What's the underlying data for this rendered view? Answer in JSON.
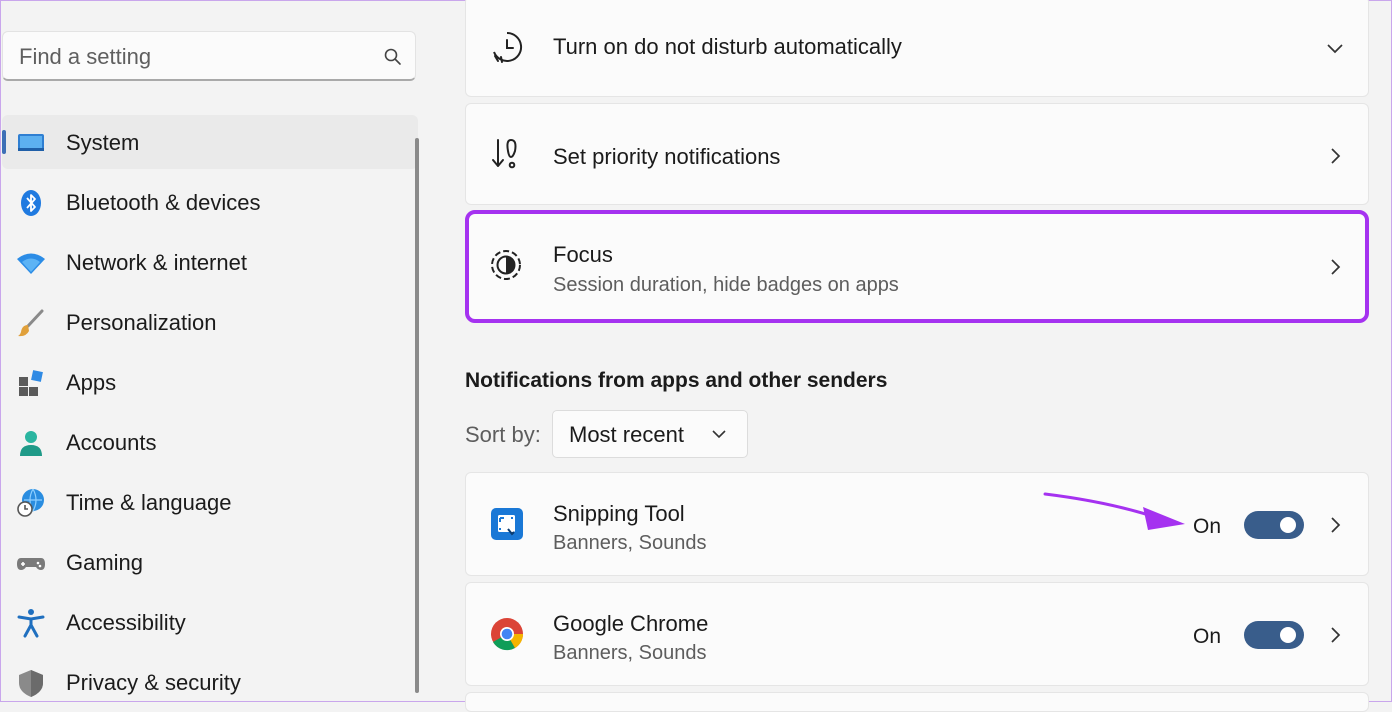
{
  "search": {
    "placeholder": "Find a setting"
  },
  "sidebar": {
    "items": [
      {
        "label": "System",
        "icon": "system-icon",
        "active": true
      },
      {
        "label": "Bluetooth & devices",
        "icon": "bluetooth-icon"
      },
      {
        "label": "Network & internet",
        "icon": "wifi-icon"
      },
      {
        "label": "Personalization",
        "icon": "brush-icon"
      },
      {
        "label": "Apps",
        "icon": "apps-icon"
      },
      {
        "label": "Accounts",
        "icon": "accounts-icon"
      },
      {
        "label": "Time & language",
        "icon": "time-language-icon"
      },
      {
        "label": "Gaming",
        "icon": "gamepad-icon"
      },
      {
        "label": "Accessibility",
        "icon": "accessibility-icon"
      },
      {
        "label": "Privacy & security",
        "icon": "shield-icon"
      }
    ]
  },
  "main": {
    "dnd": {
      "title": "Turn on do not disturb automatically",
      "icon": "clock-icon"
    },
    "priority": {
      "title": "Set priority notifications",
      "icon": "priority-icon"
    },
    "focus": {
      "title": "Focus",
      "subtitle": "Session duration, hide badges on apps",
      "icon": "focus-icon"
    },
    "section_title": "Notifications from apps and other senders",
    "sort": {
      "label": "Sort by:",
      "value": "Most recent"
    },
    "apps": [
      {
        "name": "Snipping Tool",
        "detail": "Banners, Sounds",
        "state": "On",
        "enabled": true,
        "icon": "snipping-tool-icon"
      },
      {
        "name": "Google Chrome",
        "detail": "Banners, Sounds",
        "state": "On",
        "enabled": true,
        "icon": "chrome-icon"
      }
    ]
  },
  "colors": {
    "accent": "#395d8b",
    "highlight": "#a532f0",
    "indicator": "#3d6fb6"
  }
}
